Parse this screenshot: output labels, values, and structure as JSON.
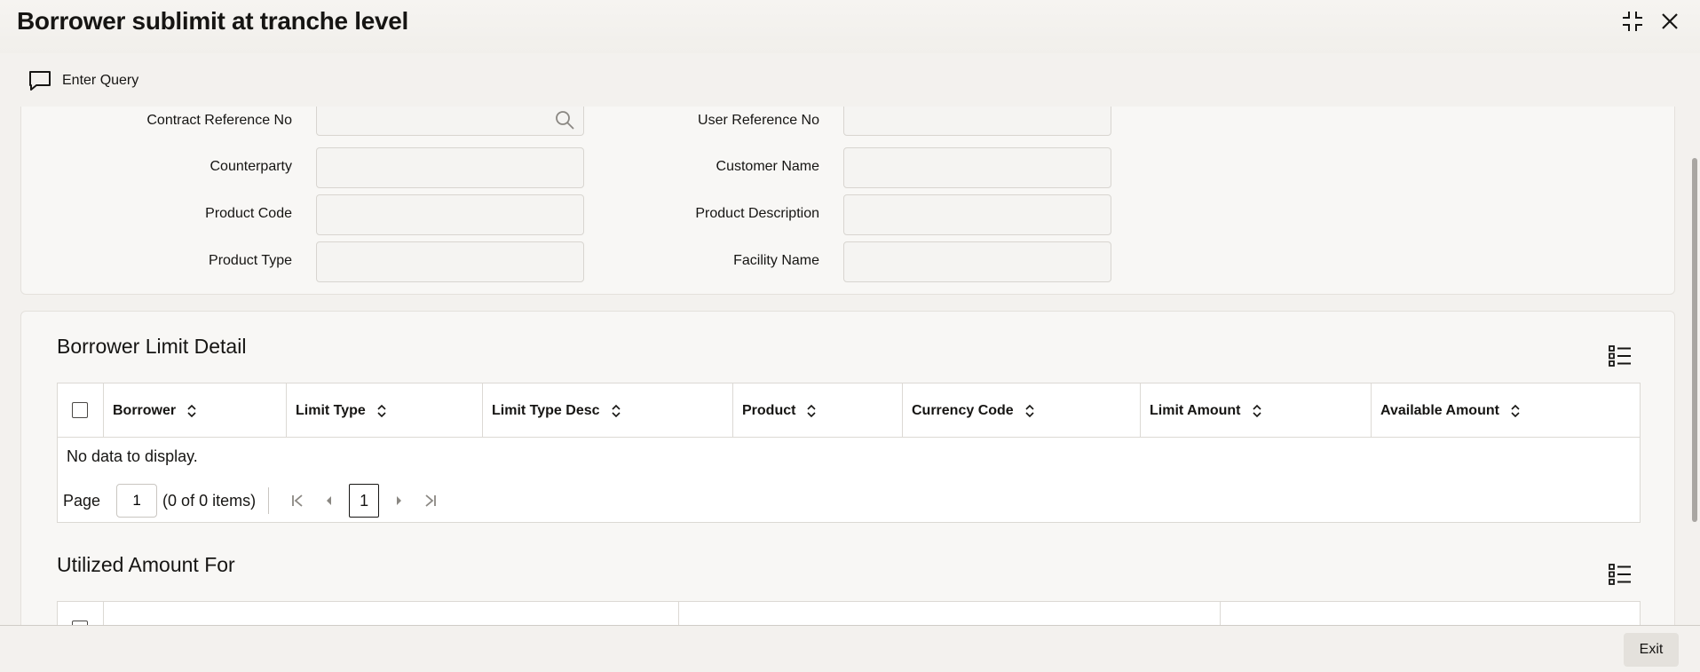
{
  "window": {
    "title": "Borrower sublimit at tranche level",
    "icons": [
      "collapse-icon",
      "close-icon"
    ]
  },
  "toolbar": {
    "enter_query_label": "Enter Query",
    "enter_query_icon": "chat-bubble-icon"
  },
  "form": {
    "contract_ref": {
      "label": "Contract Reference No",
      "value": ""
    },
    "user_ref": {
      "label": "User Reference No",
      "value": ""
    },
    "counterparty": {
      "label": "Counterparty",
      "value": ""
    },
    "customer_name": {
      "label": "Customer Name",
      "value": ""
    },
    "product_code": {
      "label": "Product Code",
      "value": ""
    },
    "product_description": {
      "label": "Product Description",
      "value": ""
    },
    "product_type": {
      "label": "Product Type",
      "value": ""
    },
    "facility_name": {
      "label": "Facility Name",
      "value": ""
    }
  },
  "borrower_limit": {
    "title": "Borrower Limit Detail",
    "columns": [
      "Borrower",
      "Limit Type",
      "Limit Type Desc",
      "Product",
      "Currency Code",
      "Limit Amount",
      "Available Amount"
    ],
    "empty_text": "No data to display.",
    "pager": {
      "page_label": "Page",
      "page_value": "1",
      "items_text": "(0 of 0 items)",
      "current_page": "1"
    }
  },
  "utilized": {
    "title": "Utilized Amount For"
  },
  "footer": {
    "exit_label": "Exit"
  },
  "colors": {
    "background": "#f3f1ee",
    "panel": "#f8f7f5",
    "border": "#dcd9d4",
    "text": "#161513"
  }
}
